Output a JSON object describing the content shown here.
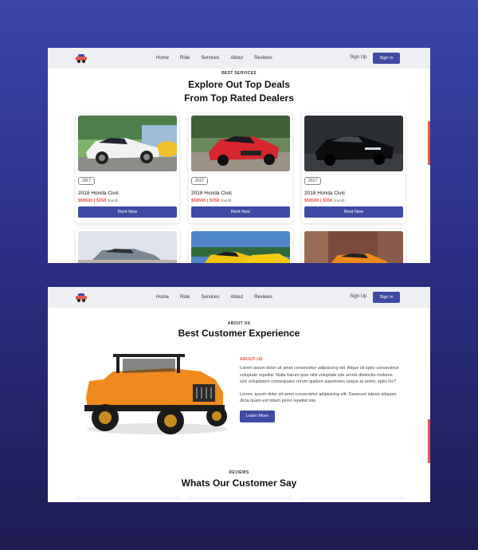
{
  "nav": {
    "links": [
      "Home",
      "Ride",
      "Services",
      "About",
      "Reviews"
    ],
    "signup": "Sign Up",
    "signin": "Sign In"
  },
  "deals": {
    "eyebrow": "BEST SERVICES",
    "title_line1": "Explore Out Top Deals",
    "title_line2": "From Top Rated Dealers",
    "cards": [
      {
        "year": "2017",
        "title": "2018 Honda Civic",
        "price": "$58500 | $358",
        "unit": "/month",
        "button": "Rent Now"
      },
      {
        "year": "2017",
        "title": "2018 Honda Civic",
        "price": "$58500 | $358",
        "unit": "/month",
        "button": "Rent Now"
      },
      {
        "year": "2017",
        "title": "2018 Honda Civic",
        "price": "$58500 | $358",
        "unit": "/month",
        "button": "Rent Now"
      }
    ]
  },
  "about": {
    "eyebrow": "ABOUT US",
    "title": "Best Customer Experience",
    "label": "ABOUT US",
    "para1": "Lorem ipsum dolor sit amet consectetur adipisicing elit. Atque sit optio consectetur voluptate repellat. Nulla harum ipsa nihil voluptate iste omnis distinctio molores iure voluptatem consequatur rerum quidem asperiores eaque at animi, optio hic?",
    "para2": "Lorem, ipsum dolor sit amet consectetur adipisicing elit. Deserunt labore aliquam dicta quam est totam porro repellat iste.",
    "button": "Learn More"
  },
  "reviews": {
    "eyebrow": "REVIEWS",
    "title": "Whats Our Customer Say"
  },
  "colors": {
    "accent": "#3f4aa3",
    "highlight": "#e2584a"
  }
}
